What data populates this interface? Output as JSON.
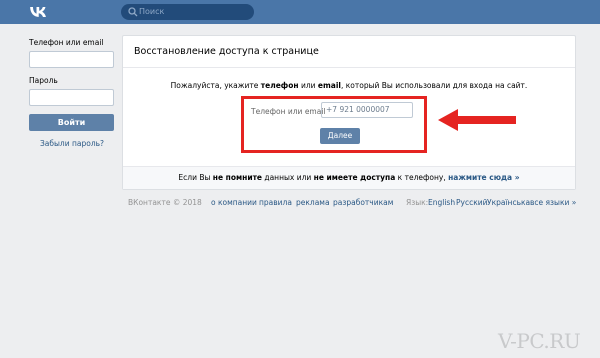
{
  "header": {
    "logo": "vk-logo",
    "search_placeholder": "Поиск"
  },
  "login": {
    "phone_label": "Телефон или email",
    "password_label": "Пароль",
    "login_button": "Войти",
    "forgot_link": "Забыли пароль?"
  },
  "restore": {
    "title": "Восстановление доступа к странице",
    "desc_prefix": "Пожалуйста, укажите ",
    "desc_bold1": "телефон",
    "desc_mid": " или ",
    "desc_bold2": "email",
    "desc_suffix": ", который Вы использовали для входа на сайт.",
    "field_label": "Телефон или email",
    "field_placeholder": "+7 921 0000007",
    "next_button": "Далее",
    "footer_prefix": "Если Вы ",
    "footer_bold1": "не помните",
    "footer_mid1": " данных или ",
    "footer_bold2": "не имеете доступа",
    "footer_mid2": " к телефону, ",
    "footer_link": "нажмите сюда »"
  },
  "footer": {
    "copyright": "ВКонтакте © 2018",
    "links": [
      "о компании",
      "правила",
      "реклама",
      "разработчикам"
    ],
    "language_label": "Язык:",
    "languages": [
      "English",
      "Русский",
      "Українська",
      "все языки »"
    ]
  },
  "watermark": "V-PC.RU",
  "colors": {
    "header": "#4a76a8",
    "button": "#5e81a8",
    "link": "#2a5885",
    "highlight": "#e52421",
    "background": "#edeef0"
  }
}
